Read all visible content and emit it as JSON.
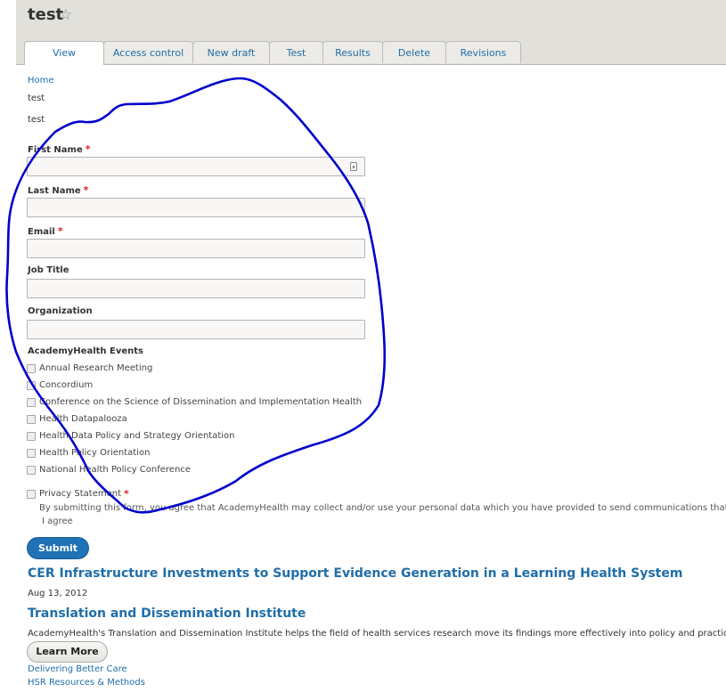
{
  "header": {
    "title": "test",
    "star_icon": "star-outline-icon",
    "tabs": [
      {
        "label": "View",
        "active": true
      },
      {
        "label": "Access control",
        "active": false
      },
      {
        "label": "New draft",
        "active": false
      },
      {
        "label": "Test",
        "active": false
      },
      {
        "label": "Results",
        "active": false
      },
      {
        "label": "Delete",
        "active": false
      },
      {
        "label": "Revisions",
        "active": false
      }
    ]
  },
  "breadcrumb": "Home",
  "intro_lines": [
    "test",
    "test"
  ],
  "form": {
    "fields": [
      {
        "label": "First Name",
        "required": "*",
        "value": ""
      },
      {
        "label": "Last Name",
        "required": "*",
        "value": ""
      },
      {
        "label": "Email",
        "required": "*",
        "value": ""
      },
      {
        "label": "Job Title",
        "required": "",
        "value": ""
      },
      {
        "label": "Organization",
        "required": "",
        "value": ""
      }
    ],
    "events_label": "AcademyHealth Events",
    "events": [
      "Annual Research Meeting",
      "Concordium",
      "Conference on the Science of Dissemination and Implementation Health",
      "Health Datapalooza",
      "Health Data Policy and Strategy Orientation",
      "Health Policy Orientation",
      "National Health Policy Conference"
    ],
    "privacy_label": "Privacy Statement",
    "privacy_required": "*",
    "privacy_description": "By submitting this form, you agree that AcademyHealth may collect and/or use your personal data which you have provided to send communications that you have agreed",
    "agree_text": "I agree",
    "submit_label": "Submit"
  },
  "articles": {
    "headline_1": "CER Infrastructure Investments to Support Evidence Generation in a Learning Health System",
    "date_1": "Aug 13, 2012",
    "headline_2": "Translation and Dissemination Institute",
    "summary_2": "AcademyHealth's Translation and Dissemination Institute helps the field of health services research move its findings more effectively into policy and practice.",
    "learn_more_label": "Learn More",
    "links": [
      "Delivering Better Care",
      "HSR Resources & Methods"
    ]
  },
  "colors": {
    "link_blue": "#1f6ea8",
    "submit_blue": "#1f72b5",
    "required_red": "#dd2222",
    "header_bg": "#e1e0da",
    "annotation_stroke": "#0000cc"
  }
}
